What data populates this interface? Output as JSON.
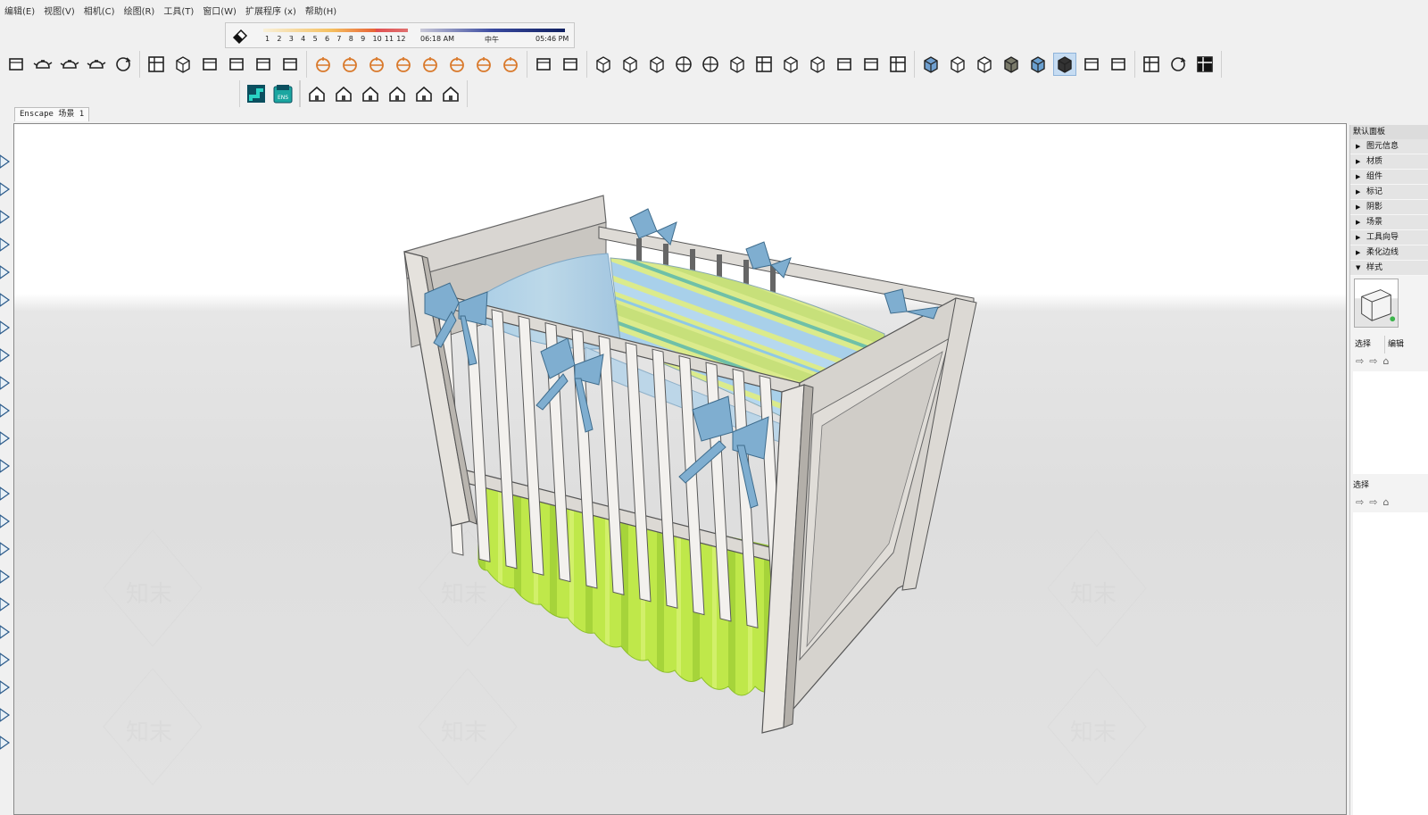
{
  "menu": [
    "编辑(E)",
    "视图(V)",
    "相机(C)",
    "绘图(R)",
    "工具(T)",
    "窗口(W)",
    "扩展程序 (x)",
    "帮助(H)"
  ],
  "shadows": {
    "months": [
      "1",
      "2",
      "3",
      "4",
      "5",
      "6",
      "7",
      "8",
      "9",
      "10",
      "11",
      "12"
    ],
    "time_start": "06:18 AM",
    "time_mid": "中午",
    "time_end": "05:46 PM"
  },
  "toolbar": {
    "icons": [
      "style-icon",
      "teapot-icon",
      "hand-teapot-icon",
      "rotate-teapot-icon",
      "orbit-icon",
      "table-icon",
      "box-icon",
      "frame-icon",
      "scene-icon",
      "shape-icon",
      "lock-icon",
      "camera-settings-icon",
      "lamp-icon",
      "sphere-light-icon",
      "cone-icon",
      "spot-icon",
      "sun-icon",
      "dome-icon",
      "globe-icon",
      "shadow-icon",
      "pattern-icon",
      "section-icon",
      "cube-wire-icon",
      "cube-solid-icon",
      "ball-icon",
      "ball2-icon",
      "hand-box-icon",
      "layer-icon",
      "iso-icon",
      "iso2-icon",
      "grass-icon",
      "pen-icon",
      "grid-icon",
      "xray-icon",
      "wire-icon",
      "hidden-icon",
      "shaded-icon",
      "texture-icon",
      "mono-icon",
      "edges-icon",
      "profile-icon",
      "list-icon",
      "ring-icon",
      "model-icon"
    ],
    "active_icon": "mono-icon"
  },
  "toolbar2": {
    "icons": [
      "enscape-logo-icon",
      "enscape-ens-icon",
      "house-a-icon",
      "door-icon",
      "house-icon",
      "roof-icon",
      "home-outline-icon",
      "garage-icon"
    ],
    "ens_label": "ENS"
  },
  "scene_tab": "Enscape 场景 1",
  "left_tools": [
    "select-icon",
    "eraser-icon",
    "line-icon",
    "rect-icon",
    "circle-icon",
    "arc-icon",
    "polygon-icon",
    "pushpull-icon",
    "move-icon",
    "rotate-icon",
    "scale-icon",
    "offset-icon",
    "tape-icon",
    "text-icon",
    "paint-icon",
    "orbit-tool-icon",
    "pan-icon",
    "zoom-icon",
    "walk-icon",
    "position-icon",
    "section-tool-icon",
    "extension-icon"
  ],
  "right_panel": {
    "title": "默认面板",
    "items": [
      {
        "label": "图元信息",
        "expanded": false
      },
      {
        "label": "材质",
        "expanded": false
      },
      {
        "label": "组件",
        "expanded": false
      },
      {
        "label": "标记",
        "expanded": false
      },
      {
        "label": "阴影",
        "expanded": false
      },
      {
        "label": "场景",
        "expanded": false
      },
      {
        "label": "工具向导",
        "expanded": false
      },
      {
        "label": "柔化边线",
        "expanded": false
      },
      {
        "label": "样式",
        "expanded": true
      }
    ],
    "select_tab": "选择",
    "edit_tab": "编辑",
    "select_label2": "选择"
  },
  "watermark": "知末"
}
